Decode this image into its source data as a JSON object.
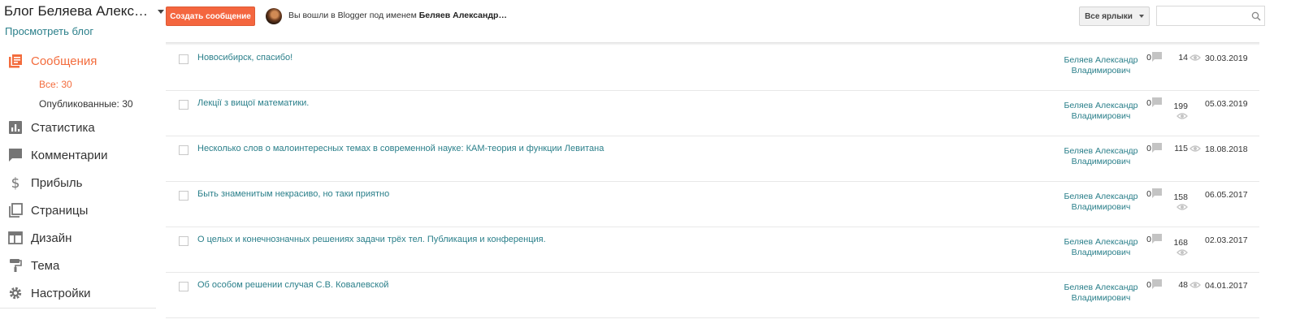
{
  "header": {
    "blog_title": "Блог Беляева Алекс…",
    "view_blog": "Просмотреть блог",
    "create_button": "Создать сообщение",
    "logged_in_prefix": "Вы вошли в Blogger под именем ",
    "logged_in_name": "Беляев Александр…",
    "labels_filter": "Все ярлыки",
    "search_placeholder": ""
  },
  "sidebar": {
    "items": [
      {
        "label": "Сообщения",
        "icon": "posts-icon",
        "active": true
      },
      {
        "label": "Статистика",
        "icon": "stats-icon"
      },
      {
        "label": "Комментарии",
        "icon": "comments-icon"
      },
      {
        "label": "Прибыль",
        "icon": "dollar-icon"
      },
      {
        "label": "Страницы",
        "icon": "pages-icon"
      },
      {
        "label": "Дизайн",
        "icon": "layout-icon"
      },
      {
        "label": "Тема",
        "icon": "paint-roller-icon"
      },
      {
        "label": "Настройки",
        "icon": "gear-icon"
      }
    ],
    "sub_items": [
      {
        "label": "Все: 30",
        "active": true
      },
      {
        "label": "Опубликованные: 30"
      }
    ]
  },
  "colors": {
    "accent": "#f36c3d",
    "link": "#2a7f8a"
  },
  "posts": [
    {
      "title": "Новосибирск, спасибо!",
      "author": "Беляев Александр Владимирович",
      "comments": "0",
      "views": "14",
      "date": "30.03.2019"
    },
    {
      "title": "Лекції з вищої математики.",
      "author": "Беляев Александр Владимирович",
      "comments": "0",
      "views": "199",
      "date": "05.03.2019"
    },
    {
      "title": "Несколько слов о малоинтересных темах в современной науке: КАМ-теория и функции Левитана",
      "author": "Беляев Александр Владимирович",
      "comments": "0",
      "views": "115",
      "date": "18.08.2018"
    },
    {
      "title": "Быть знаменитым некрасиво, но таки приятно",
      "author": "Беляев Александр Владимирович",
      "comments": "0",
      "views": "158",
      "date": "06.05.2017"
    },
    {
      "title": "О целых и конечнозначных решениях задачи трёх тел. Публикация и конференция.",
      "author": "Беляев Александр Владимирович",
      "comments": "0",
      "views": "168",
      "date": "02.03.2017"
    },
    {
      "title": "Об особом решении случая С.В. Ковалевской",
      "author": "Беляев Александр Владимирович",
      "comments": "0",
      "views": "48",
      "date": "04.01.2017"
    }
  ]
}
